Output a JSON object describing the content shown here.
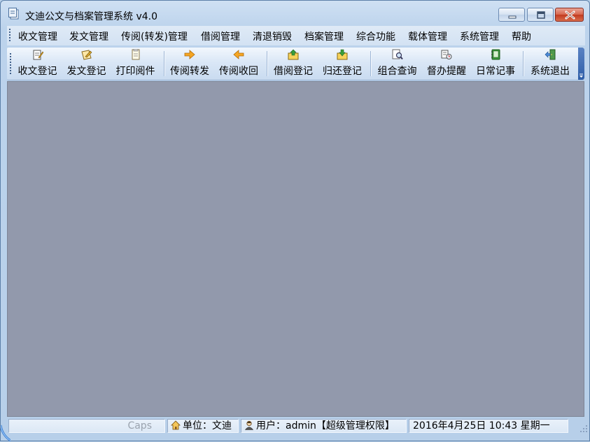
{
  "window": {
    "title": "文迪公文与档案管理系统 v4.0"
  },
  "menu": [
    "收文管理",
    "发文管理",
    "传阅(转发)管理",
    "借阅管理",
    "清退销毁",
    "档案管理",
    "综合功能",
    "载体管理",
    "系统管理",
    "帮助"
  ],
  "toolbar": [
    {
      "label": "收文登记",
      "icon": "receive-register-icon"
    },
    {
      "label": "发文登记",
      "icon": "send-register-icon"
    },
    {
      "label": "打印阅件",
      "icon": "print-document-icon"
    },
    {
      "label": "传阅转发",
      "icon": "forward-arrow-icon"
    },
    {
      "label": "传阅收回",
      "icon": "recall-arrow-icon"
    },
    {
      "label": "借阅登记",
      "icon": "borrow-register-icon"
    },
    {
      "label": "归还登记",
      "icon": "return-register-icon"
    },
    {
      "label": "组合查询",
      "icon": "search-query-icon"
    },
    {
      "label": "督办提醒",
      "icon": "reminder-icon"
    },
    {
      "label": "日常记事",
      "icon": "notebook-icon"
    },
    {
      "label": "系统退出",
      "icon": "exit-door-icon"
    }
  ],
  "statusbar": {
    "caps": "Caps",
    "unit": "单位：文迪",
    "user": "用户：admin【超级管理权限】",
    "datetime": "2016年4月25日 10:43 星期一"
  },
  "colors": {
    "client_background": "#9299ac",
    "frame": "#b9d1ea",
    "close_button": "#c23b1f"
  }
}
